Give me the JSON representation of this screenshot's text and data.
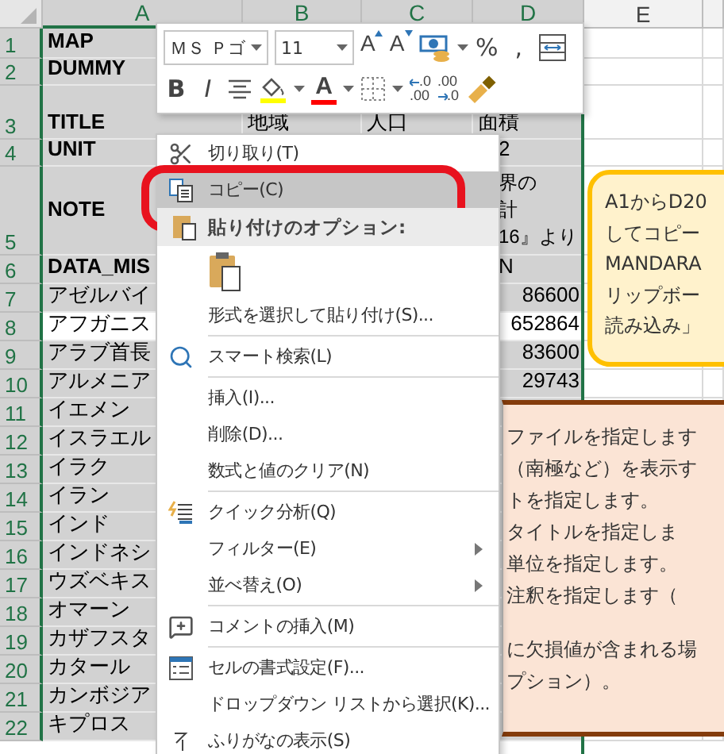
{
  "columns": [
    {
      "label": "A",
      "selected": true
    },
    {
      "label": "B",
      "selected": true
    },
    {
      "label": "C",
      "selected": true
    },
    {
      "label": "D",
      "selected": true
    },
    {
      "label": "E",
      "selected": false
    }
  ],
  "rows": [
    {
      "number": "1",
      "active": false,
      "cells": {
        "a": "MAP"
      }
    },
    {
      "number": "2",
      "active": false,
      "cells": {
        "a": "DUMMY"
      }
    },
    {
      "number": "3",
      "active": false,
      "cells": {
        "a": "TITLE",
        "b": "地域",
        "c": "人口",
        "d": "面積"
      }
    },
    {
      "number": "4",
      "active": false,
      "cells": {
        "a": "UNIT",
        "d": "2"
      }
    },
    {
      "number": "5",
      "active": false,
      "cells": {
        "a": "NOTE",
        "d": [
          "界の",
          "計",
          "16』より"
        ]
      }
    },
    {
      "number": "6",
      "active": false,
      "cells": {
        "a": "DATA_MIS",
        "d": "N"
      }
    },
    {
      "number": "7",
      "active": false,
      "cells": {
        "a": "アゼルバイ",
        "d": "86600"
      }
    },
    {
      "number": "8",
      "active": true,
      "cells": {
        "a": "アフガニス",
        "d": "652864"
      }
    },
    {
      "number": "9",
      "active": false,
      "cells": {
        "a": "アラブ首長",
        "d": "83600"
      }
    },
    {
      "number": "10",
      "active": false,
      "cells": {
        "a": "アルメニア",
        "d": "29743"
      }
    },
    {
      "number": "11",
      "active": false,
      "cells": {
        "a": "イエメン"
      }
    },
    {
      "number": "12",
      "active": false,
      "cells": {
        "a": "イスラエル"
      }
    },
    {
      "number": "13",
      "active": false,
      "cells": {
        "a": "イラク"
      }
    },
    {
      "number": "14",
      "active": false,
      "cells": {
        "a": "イラン"
      }
    },
    {
      "number": "15",
      "active": false,
      "cells": {
        "a": "インド"
      }
    },
    {
      "number": "16",
      "active": false,
      "cells": {
        "a": "インドネシ"
      }
    },
    {
      "number": "17",
      "active": false,
      "cells": {
        "a": "ウズベキス"
      }
    },
    {
      "number": "18",
      "active": false,
      "cells": {
        "a": "オマーン"
      }
    },
    {
      "number": "19",
      "active": false,
      "cells": {
        "a": "カザフスタ"
      }
    },
    {
      "number": "20",
      "active": false,
      "cells": {
        "a": "カタール"
      }
    },
    {
      "number": "21",
      "active": false,
      "cells": {
        "a": "カンボジア"
      }
    },
    {
      "number": "22",
      "active": false,
      "cells": {
        "a": "キプロス"
      }
    }
  ],
  "mini_toolbar": {
    "font_row": [
      {
        "kind": "font-name",
        "value": "ＭＳ Ｐゴ"
      },
      {
        "kind": "font-size",
        "value": "11"
      },
      {
        "kind": "grow",
        "label": "A"
      },
      {
        "kind": "shrink",
        "label": "A"
      },
      {
        "kind": "accounting"
      },
      {
        "kind": "text",
        "label": "%"
      },
      {
        "kind": "text",
        "label": ","
      },
      {
        "kind": "wrap"
      }
    ],
    "format_row": [
      {
        "kind": "bold",
        "label": "B"
      },
      {
        "kind": "italic",
        "label": "I"
      },
      {
        "kind": "align"
      },
      {
        "kind": "fill",
        "color": "#ffff00"
      },
      {
        "kind": "font-color",
        "label": "A",
        "color": "#ff0000"
      },
      {
        "kind": "borders"
      },
      {
        "kind": "decimal-more",
        "top": ".0",
        "bottom": ".00"
      },
      {
        "kind": "decimal-less",
        "top": ".00",
        "bottom": ".0"
      },
      {
        "kind": "painter"
      }
    ]
  },
  "context_menu": [
    {
      "kind": "item",
      "label": "切り取り(T)",
      "selected": false,
      "submenu": false,
      "ringed": false
    },
    {
      "kind": "item",
      "label": "コピー(C)",
      "selected": true,
      "submenu": false,
      "ringed": true
    },
    {
      "kind": "header",
      "label": "貼り付けのオプション:"
    },
    {
      "kind": "paste-options"
    },
    {
      "kind": "item",
      "label": "形式を選択して貼り付け(S)...",
      "selected": false,
      "submenu": false,
      "ringed": false
    },
    {
      "kind": "separator"
    },
    {
      "kind": "item",
      "label": "スマート検索(L)",
      "selected": false,
      "submenu": false,
      "ringed": false
    },
    {
      "kind": "separator"
    },
    {
      "kind": "item",
      "label": "挿入(I)...",
      "selected": false,
      "submenu": false,
      "ringed": false
    },
    {
      "kind": "item",
      "label": "削除(D)...",
      "selected": false,
      "submenu": false,
      "ringed": false
    },
    {
      "kind": "item",
      "label": "数式と値のクリア(N)",
      "selected": false,
      "submenu": false,
      "ringed": false
    },
    {
      "kind": "separator"
    },
    {
      "kind": "item",
      "label": "クイック分析(Q)",
      "selected": false,
      "submenu": false,
      "ringed": false
    },
    {
      "kind": "item",
      "label": "フィルター(E)",
      "selected": false,
      "submenu": true,
      "ringed": false
    },
    {
      "kind": "item",
      "label": "並べ替え(O)",
      "selected": false,
      "submenu": true,
      "ringed": false
    },
    {
      "kind": "separator"
    },
    {
      "kind": "item",
      "label": "コメントの挿入(M)",
      "selected": false,
      "submenu": false,
      "ringed": false
    },
    {
      "kind": "separator"
    },
    {
      "kind": "item",
      "label": "セルの書式設定(F)...",
      "selected": false,
      "submenu": false,
      "ringed": false
    },
    {
      "kind": "item",
      "label": "ドロップダウン リストから選択(K)...",
      "selected": false,
      "submenu": false,
      "ringed": false
    },
    {
      "kind": "item",
      "label": "ふりがなの表示(S)",
      "selected": false,
      "submenu": false,
      "ringed": false
    }
  ],
  "notes": [
    {
      "kind": "yellow",
      "paragraphs": [
        [
          "A1からD20",
          "してコピー",
          "MANDARA",
          "リップボー",
          "読み込み」"
        ]
      ]
    },
    {
      "kind": "peach",
      "paragraphs": [
        [
          "ファイルを指定します",
          "（南極など）を表示す",
          "トを指定します。",
          "タイトルを指定しま",
          "単位を指定します。",
          "注釈を指定します（"
        ],
        [
          "に欠損値が含まれる場",
          "プション）。"
        ]
      ]
    }
  ]
}
